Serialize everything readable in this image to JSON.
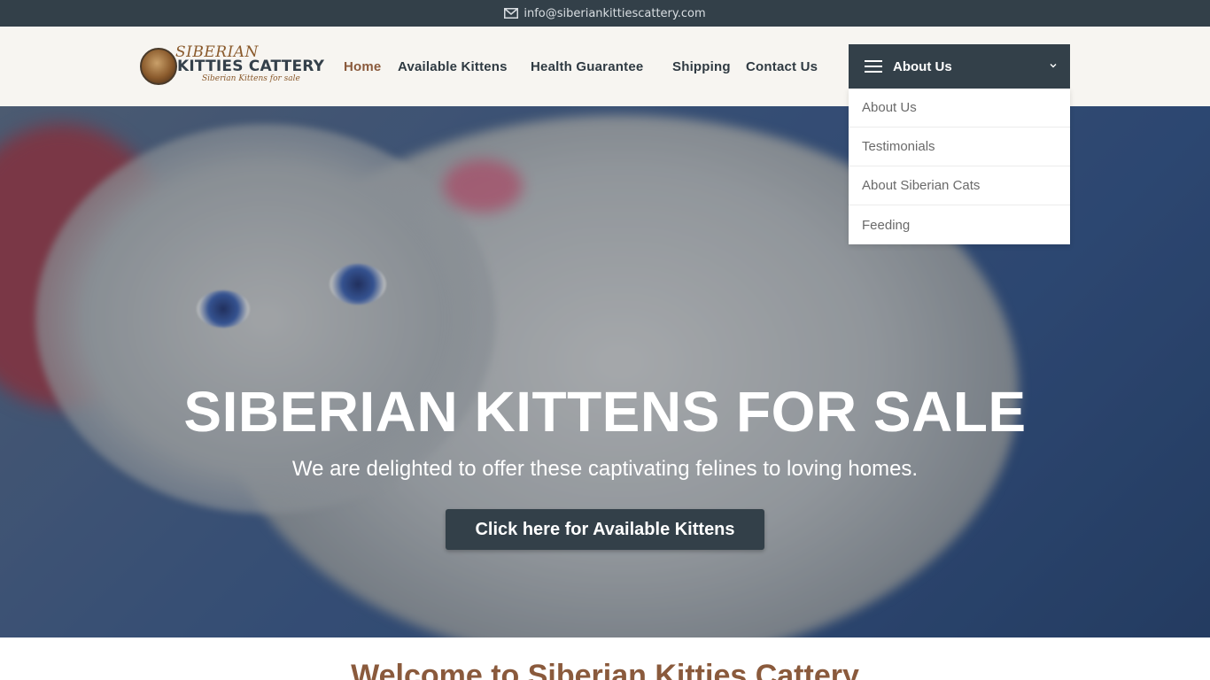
{
  "topbar": {
    "email": "info@siberiankittiescattery.com",
    "icon": "mail-icon"
  },
  "logo": {
    "line1": "SIBERIAN",
    "line2": "KITTIES CATTERY",
    "line3": "Siberian Kittens for sale"
  },
  "nav": {
    "items": [
      {
        "label": "Home",
        "active": true
      },
      {
        "label": "Available Kittens",
        "active": false
      },
      {
        "label": "Health Guarantee",
        "active": false
      },
      {
        "label": "Shipping",
        "active": false
      },
      {
        "label": "Contact Us",
        "active": false
      }
    ]
  },
  "dropdown": {
    "label": "About Us",
    "items": [
      "About Us",
      "Testimonials",
      "About Siberian Cats",
      "Feeding"
    ]
  },
  "hero": {
    "title": "SIBERIAN KITTENS FOR SALE",
    "subtitle": "We are delighted to offer these captivating felines to loving homes.",
    "cta_label": "Click here for Available Kittens"
  },
  "welcome": {
    "title": "Welcome to Siberian Kitties Cattery"
  },
  "colors": {
    "dark": "#334049",
    "accent": "#8a5a3c",
    "header_bg": "#f7f5f1"
  }
}
